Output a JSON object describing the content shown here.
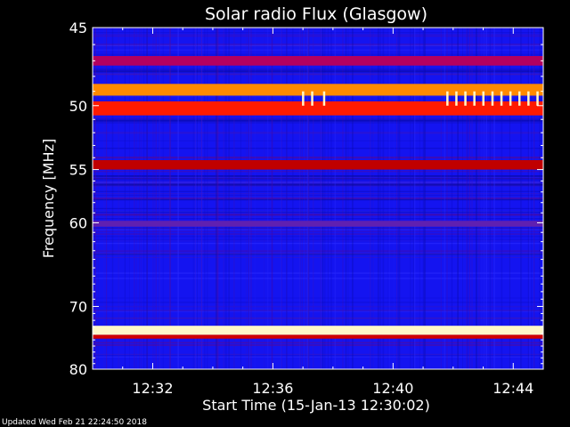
{
  "chart_data": {
    "type": "heatmap",
    "title": "Solar radio Flux (Glasgow)",
    "xlabel": "Start Time (15-Jan-13 12:30:02)",
    "ylabel": "Frequency [MHz]",
    "x_unit": "minutes after 12:30:02",
    "x_range": [
      0,
      15
    ],
    "x_ticks": [
      {
        "label": "12:32",
        "value": 2.0
      },
      {
        "label": "12:36",
        "value": 6.0
      },
      {
        "label": "12:40",
        "value": 10.0
      },
      {
        "label": "12:44",
        "value": 14.0
      }
    ],
    "y_range": [
      45,
      80
    ],
    "y_scale": "inverse (frequency increases downward)",
    "y_ticks": [
      45,
      50,
      55,
      60,
      70,
      80
    ],
    "colormap": [
      "#000080",
      "#1010ff",
      "#b00000",
      "#ff2000",
      "#ff8000",
      "#fff8c0"
    ],
    "bands": [
      {
        "freq": 47.0,
        "width": 0.3,
        "intensity": "medium",
        "color": "#b40060"
      },
      {
        "freq": 48.9,
        "width": 0.4,
        "intensity": "high",
        "color": "#ff8a00"
      },
      {
        "freq": 50.2,
        "width": 0.5,
        "intensity": "high",
        "color": "#ff1a00"
      },
      {
        "freq": 54.6,
        "width": 0.4,
        "intensity": "medium",
        "color": "#c00000"
      },
      {
        "freq": 60.1,
        "width": 0.3,
        "intensity": "low",
        "color": "#6020b0"
      },
      {
        "freq": 73.5,
        "width": 0.7,
        "intensity": "saturated",
        "color": "#fff8c8"
      },
      {
        "freq": 74.5,
        "width": 0.3,
        "intensity": "high",
        "color": "#d00000"
      }
    ],
    "bursts": [
      {
        "time": 7.0,
        "freq_range": [
          49.0,
          50.0
        ]
      },
      {
        "time": 7.3,
        "freq_range": [
          49.0,
          50.0
        ]
      },
      {
        "time": 7.7,
        "freq_range": [
          49.0,
          50.0
        ]
      },
      {
        "time": 11.8,
        "freq_range": [
          49.0,
          50.0
        ]
      },
      {
        "time": 12.1,
        "freq_range": [
          49.0,
          50.0
        ]
      },
      {
        "time": 12.4,
        "freq_range": [
          49.0,
          50.0
        ]
      },
      {
        "time": 12.7,
        "freq_range": [
          49.0,
          50.0
        ]
      },
      {
        "time": 13.0,
        "freq_range": [
          49.0,
          50.0
        ]
      },
      {
        "time": 13.3,
        "freq_range": [
          49.0,
          50.0
        ]
      },
      {
        "time": 13.6,
        "freq_range": [
          49.0,
          50.0
        ]
      },
      {
        "time": 13.9,
        "freq_range": [
          49.0,
          50.0
        ]
      },
      {
        "time": 14.2,
        "freq_range": [
          49.0,
          50.0
        ]
      },
      {
        "time": 14.5,
        "freq_range": [
          49.0,
          50.0
        ]
      },
      {
        "time": 14.8,
        "freq_range": [
          49.0,
          50.0
        ]
      }
    ],
    "grid": false,
    "legend": "none"
  },
  "footer": {
    "updated": "Updated Wed Feb 21 22:24:50 2018"
  }
}
